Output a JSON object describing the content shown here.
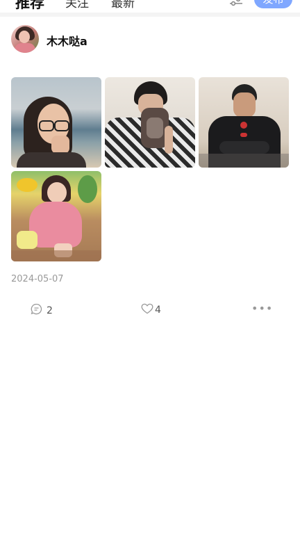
{
  "tabs": [
    {
      "label": "推荐"
    },
    {
      "label": "关注"
    },
    {
      "label": "最新"
    }
  ],
  "header": {
    "publish_label": "发布",
    "filter_icon": "filter-sliders-icon"
  },
  "post": {
    "author": "木木哒a",
    "date": "2024-05-07",
    "comment_count": "2",
    "like_count": "4",
    "more_label": "•••",
    "images": [
      {
        "name": "photo-girl-glasses-beach"
      },
      {
        "name": "photo-boy-holding-cat-mask"
      },
      {
        "name": "photo-boy-black-jacket"
      },
      {
        "name": "photo-girl-pink-dress-garden"
      }
    ]
  },
  "colors": {
    "accent": "#7fa7ff",
    "muted_text": "#999999",
    "divider": "#f4f4f4"
  }
}
